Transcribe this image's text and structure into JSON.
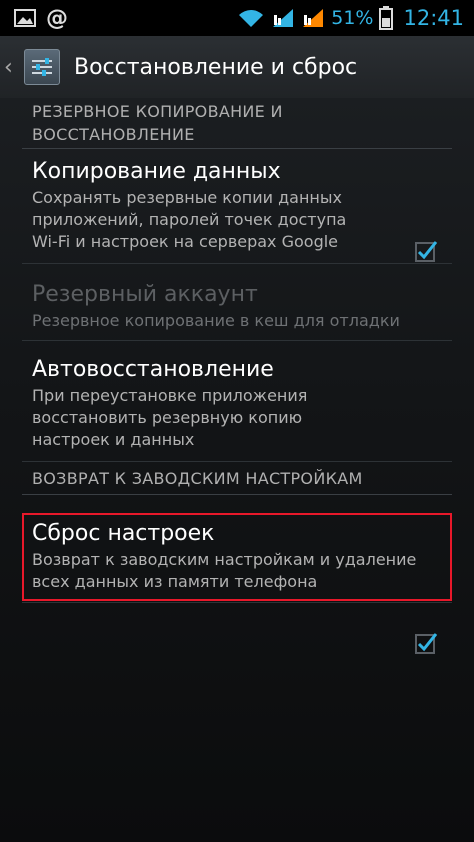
{
  "status_bar": {
    "at_symbol": "@",
    "battery_percent": "51%",
    "time": "12:41",
    "icons": [
      "image-icon",
      "wifi-icon",
      "signal-1-icon",
      "signal-2-icon",
      "battery-icon"
    ]
  },
  "action_bar": {
    "title": "Восстановление и сброс",
    "up_icon": "chevron-left-icon",
    "app_icon": "settings-sliders-icon"
  },
  "sections": {
    "backup_header": "РЕЗЕРВНОЕ КОПИРОВАНИЕ И ВОССТАНОВЛЕНИЕ",
    "factory_header": "ВОЗВРАТ К ЗАВОДСКИМ НАСТРОЙКАМ"
  },
  "items": {
    "backup": {
      "title": "Копирование данных",
      "summary": "Сохранять резервные копии данных приложений, паролей точек доступа Wi-Fi и настроек на серверах Google",
      "checked": true
    },
    "backup_account": {
      "title": "Резервный аккаунт",
      "summary": "Резервное копирование в кеш для отладки",
      "enabled": false
    },
    "auto_restore": {
      "title": "Автовосстановление",
      "summary": "При переустановке приложения восстановить резервную копию настроек и данных",
      "checked": true
    },
    "factory_reset": {
      "title": "Сброс настроек",
      "summary": "Возврат к заводским настройкам и удаление всех данных из памяти телефона"
    }
  },
  "colors": {
    "accent": "#33b5e5",
    "highlight_border": "#e8182a",
    "background": "#131517"
  }
}
